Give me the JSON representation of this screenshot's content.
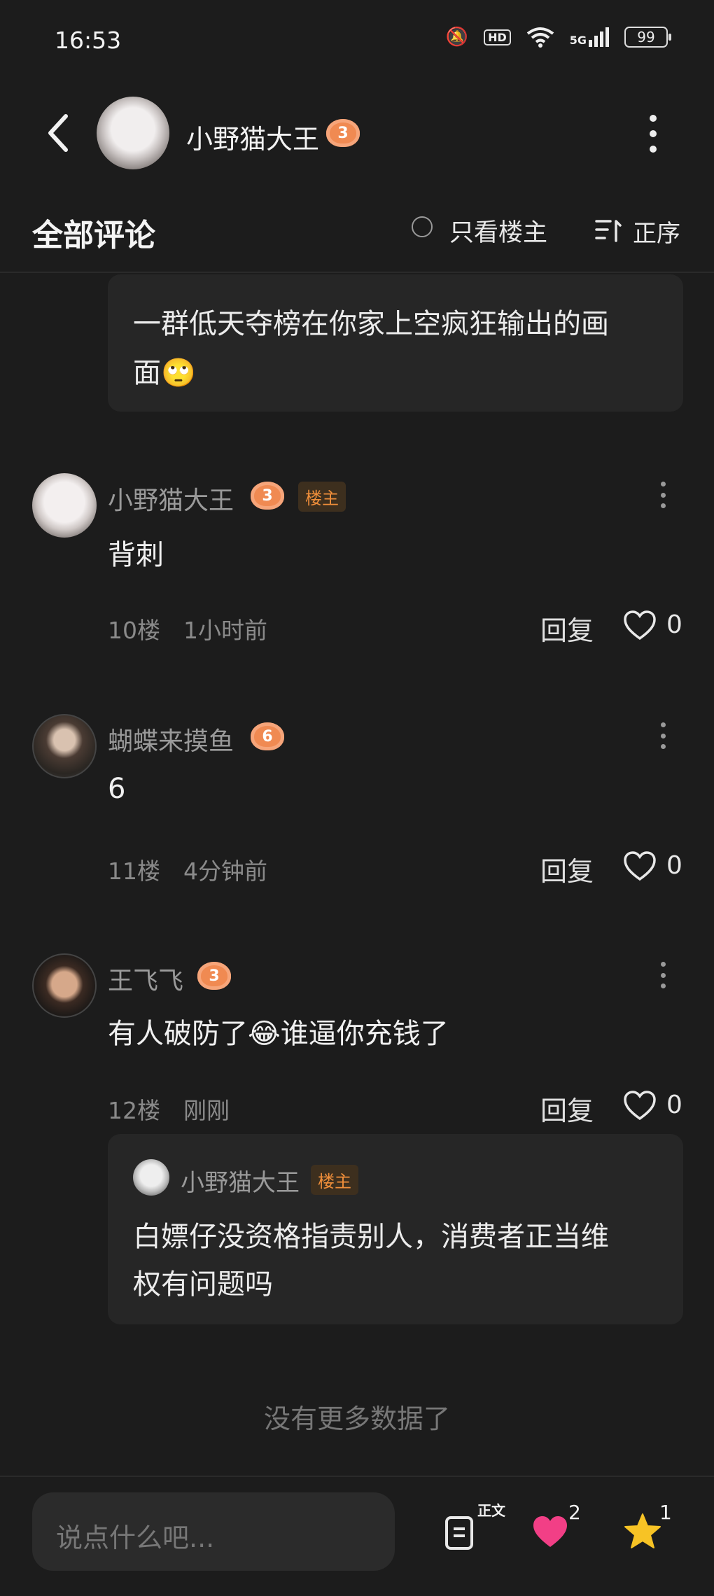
{
  "status_bar": {
    "time": "16:53",
    "hd": "HD",
    "network": "5G",
    "battery": "99"
  },
  "header": {
    "username": "小野猫大王",
    "level": "3"
  },
  "section": {
    "title": "全部评论",
    "only_op": "只看楼主",
    "sort": "正序"
  },
  "top_reply": {
    "text_line1": "一群低天夺榜在你家上空疯狂输出的画",
    "text_line2": "面🙄"
  },
  "comments": [
    {
      "name": "小野猫大王",
      "level": "3",
      "op_badge": "楼主",
      "text": "背刺",
      "floor": "10楼",
      "time": "1小时前",
      "reply_label": "回复",
      "likes": "0"
    },
    {
      "name": "蝴蝶来摸鱼",
      "level": "6",
      "text": "6",
      "floor": "11楼",
      "time": "4分钟前",
      "reply_label": "回复",
      "likes": "0"
    },
    {
      "name": "王飞飞",
      "level": "3",
      "text": "有人破防了😂谁逼你充钱了",
      "floor": "12楼",
      "time": "刚刚",
      "reply_label": "回复",
      "likes": "0",
      "reply": {
        "name": "小野猫大王",
        "op_badge": "楼主",
        "text_line1": "白嫖仔没资格指责别人，消费者正当维",
        "text_line2": "权有问题吗"
      }
    }
  ],
  "footer": {
    "no_more": "没有更多数据了"
  },
  "bottom_bar": {
    "placeholder": "说点什么吧...",
    "doc_label": "正文",
    "likes": "2",
    "stars": "1"
  },
  "colors": {
    "background": "#1c1c1c",
    "badge_orange": "#f08a52",
    "heart": "#f23f86",
    "star": "#f7c325"
  }
}
